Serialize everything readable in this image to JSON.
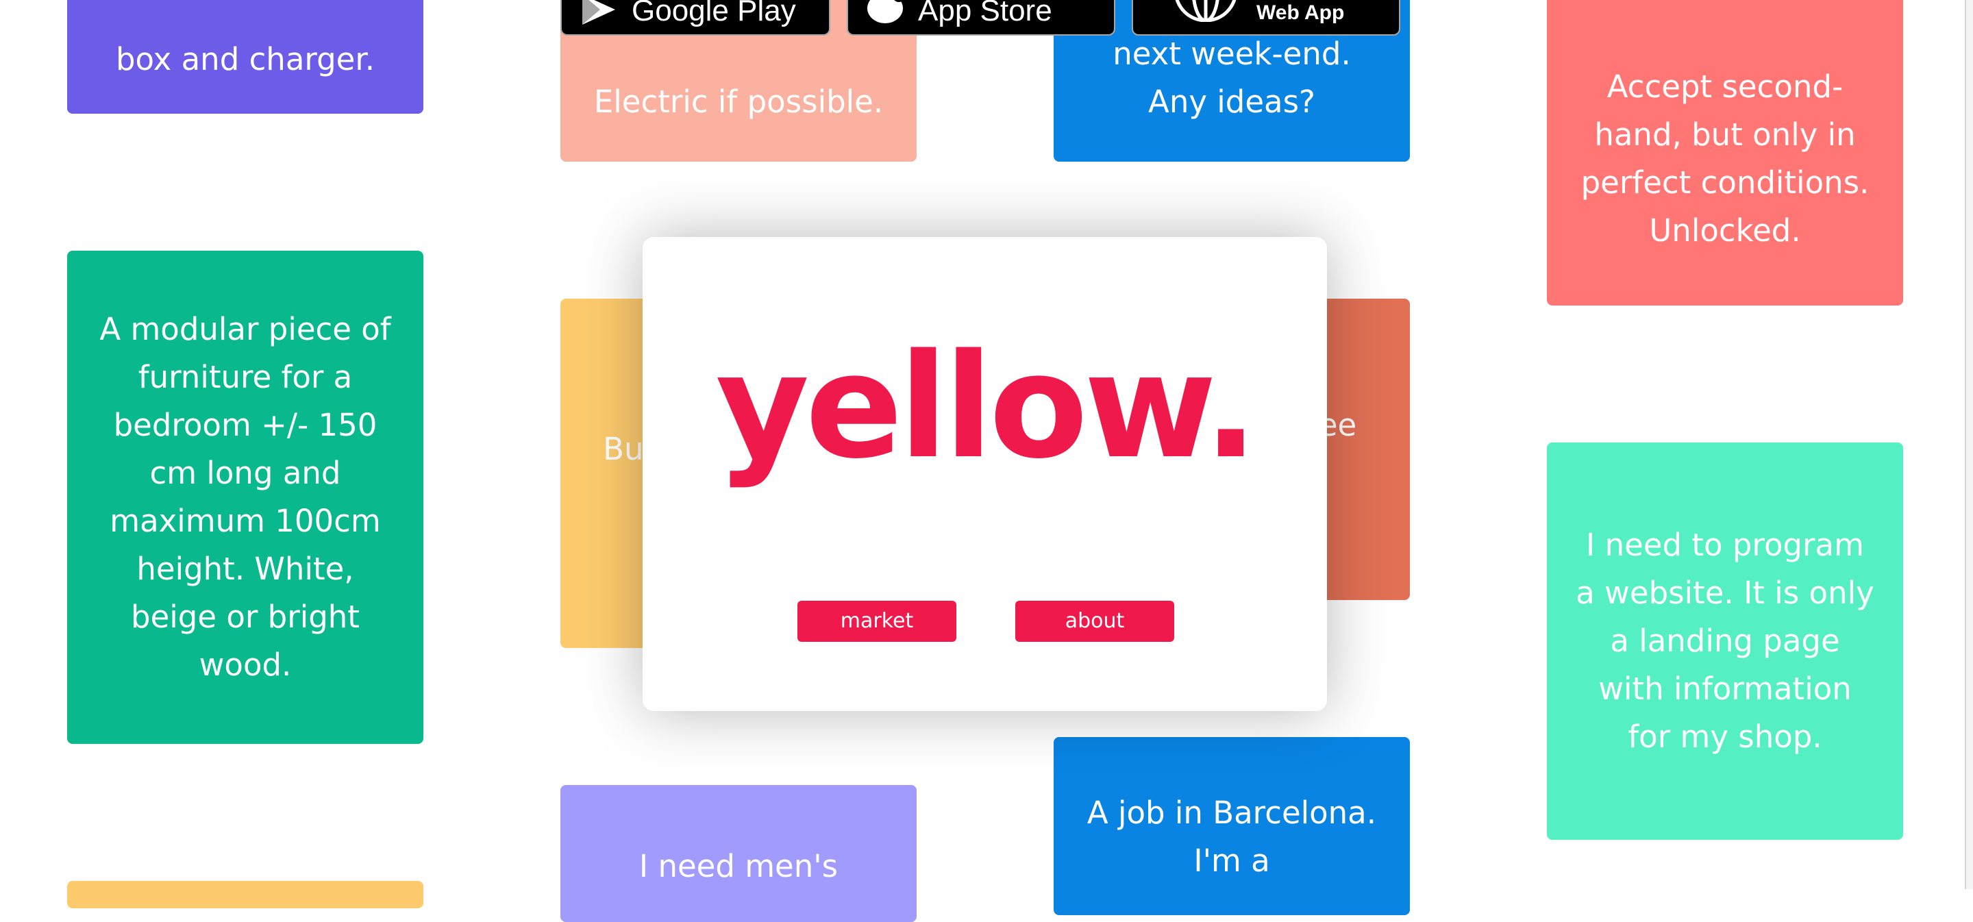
{
  "cards": [
    {
      "text": "box and charger.",
      "color": "#6c5ce7"
    },
    {
      "text": "Electric if possible.",
      "color": "#fab1a0"
    },
    {
      "text": "next week-end. Any ideas?",
      "color": "#0984e3"
    },
    {
      "text": "Accept second-hand, but only in perfect conditions. Unlocked.",
      "color": "#ff7675"
    },
    {
      "text": "A modular piece of furniture for a bedroom +/- 150 cm long and maximum 100cm height. White, beige or bright wood.",
      "color": "#0ab88e"
    },
    {
      "text": "Buy a ring. New... A",
      "color": "#fdcb6e"
    },
    {
      "text": "...ter ...or a ...ee ...gn?",
      "color": "#e17055"
    },
    {
      "text": "I need to program a website. It is only a landing page with information for my shop.",
      "color": "#55efc4"
    },
    {
      "text": "I need men's",
      "color": "#a29bfe"
    },
    {
      "text": "A job in Barcelona. I'm a",
      "color": "#0984e3"
    },
    {
      "text": "",
      "color": "#fdcb6e"
    }
  ],
  "stores": {
    "google_play": "Google Play",
    "app_store": "App Store",
    "web_app": "Web App"
  },
  "overlay": {
    "logo": "yellow.",
    "market_label": "market",
    "about_label": "about",
    "brand_color": "#ef1a4b"
  }
}
